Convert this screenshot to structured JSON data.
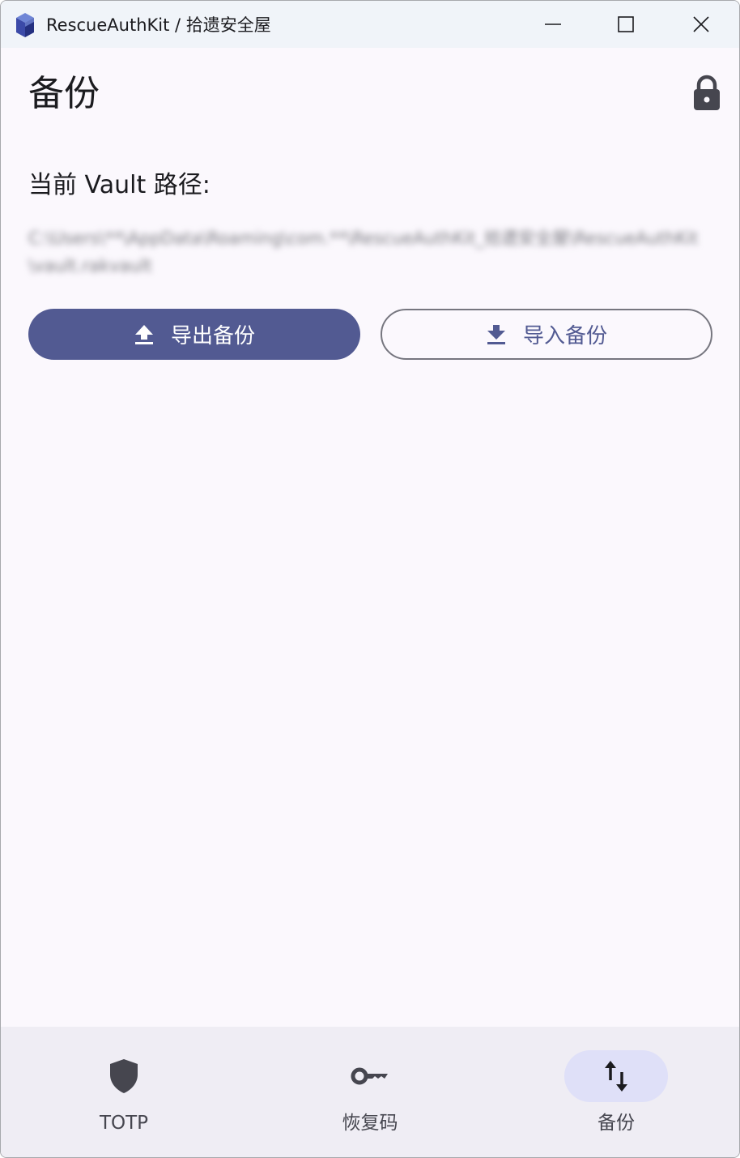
{
  "window": {
    "title": "RescueAuthKit / 拾遗安全屋",
    "controls": {
      "minimize_icon": "minimize-icon",
      "maximize_icon": "maximize-icon",
      "close_icon": "close-icon"
    }
  },
  "page": {
    "title": "备份",
    "lock_icon": "lock-icon"
  },
  "vault": {
    "path_label": "当前 Vault 路径:",
    "path_value": "C:\\Users\\**\\AppData\\Roaming\\com.**\\RescueAuthKit_拾遗安全屋\\RescueAuthKit\\vault.rakvault"
  },
  "actions": {
    "export_label": "导出备份",
    "export_icon": "upload-icon",
    "import_label": "导入备份",
    "import_icon": "download-icon"
  },
  "nav": {
    "items": [
      {
        "label": "TOTP",
        "icon": "shield-icon",
        "active": false
      },
      {
        "label": "恢复码",
        "icon": "key-icon",
        "active": false
      },
      {
        "label": "备份",
        "icon": "swap-vertical-icon",
        "active": true
      }
    ]
  },
  "colors": {
    "primary": "#525a92",
    "background": "#fbf8fd",
    "nav_background": "#efedf4",
    "nav_active_pill": "#dfe0f8",
    "titlebar": "#f0f4f9",
    "text": "#1b1b1f"
  }
}
